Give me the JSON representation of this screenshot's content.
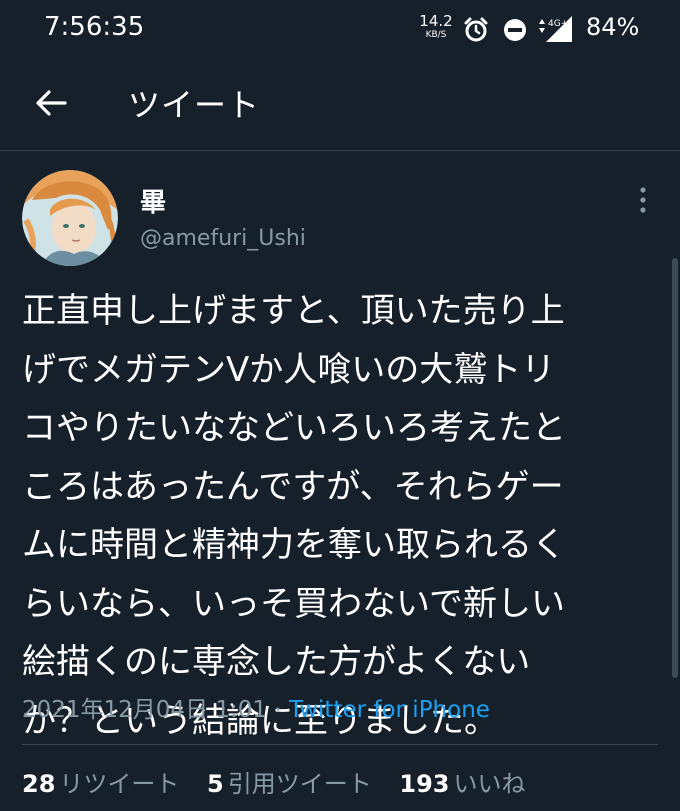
{
  "status_bar": {
    "time": "7:56:35",
    "net_speed_value": "14.2",
    "net_speed_unit": "KB/S",
    "network_label": "4G+",
    "battery": "84%",
    "icons": [
      "alarm-icon",
      "do-not-disturb-icon",
      "signal-icon"
    ]
  },
  "header": {
    "title": "ツイート",
    "back_icon": "arrow-left-icon"
  },
  "tweet": {
    "display_name": "畢",
    "handle": "@amefuri_Ushi",
    "text": "正直申し上げますと、頂いた売り上\nげでメガテンVか人喰いの大鷲トリ\nコやりたいななどいろいろ考えたと\nころはあったんですが、それらゲー\nムに時間と精神力を奪い取られるく\nらいなら、いっそ買わないで新しい\n絵描くのに専念した方がよくない\nか？という結論に至りました。",
    "timestamp": "2021年12月04日 1:01",
    "separator": "·",
    "source": "Twitter for iPhone"
  },
  "stats": {
    "retweets_count": "28",
    "retweets_label": "リツイート",
    "quotes_count": "5",
    "quotes_label": "引用ツイート",
    "likes_count": "193",
    "likes_label": "いいね"
  },
  "colors": {
    "background": "#15202b",
    "text": "#ffffff",
    "secondary_text": "#8899a6",
    "link": "#1da1f2",
    "divider": "#38444d"
  }
}
